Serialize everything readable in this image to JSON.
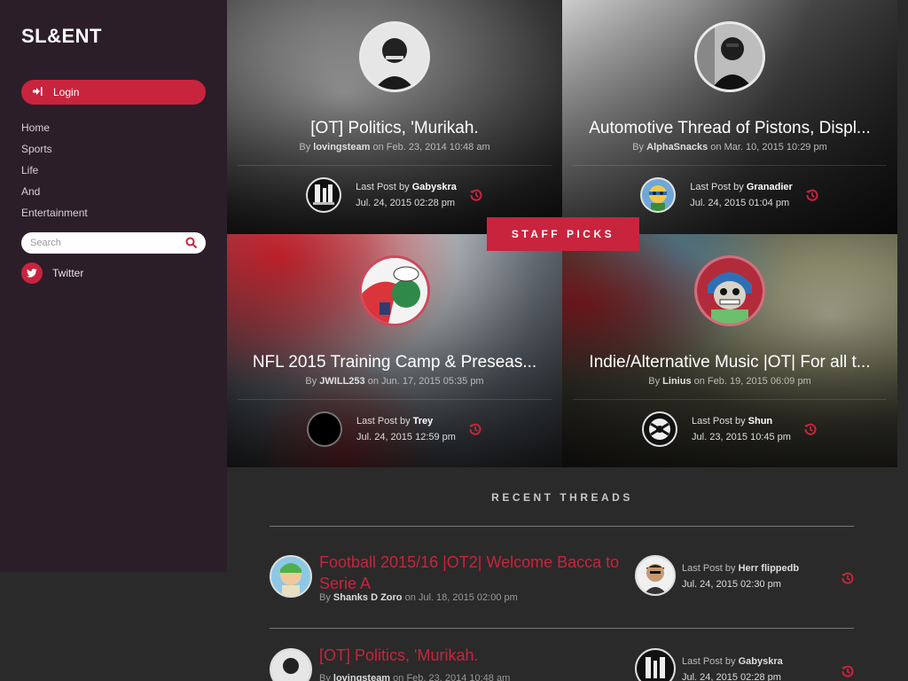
{
  "sidebar": {
    "logo": "SL&ENT",
    "login_label": "Login",
    "nav": [
      "Home",
      "Sports",
      "Life",
      "And",
      "Entertainment"
    ],
    "search_placeholder": "Search",
    "twitter_label": "Twitter"
  },
  "staff_picks_label": "STAFF PICKS",
  "tiles": [
    {
      "title": "[OT] Politics, 'Murikah.",
      "by": "By",
      "author": "lovingsteam",
      "on": "on Feb. 23, 2014 10:48 am",
      "last_post_label": "Last Post by",
      "last_user": "Gabyskra",
      "last_date": "Jul. 24, 2015 02:28 pm"
    },
    {
      "title": "Automotive Thread of Pistons, Displ...",
      "by": "By",
      "author": "AlphaSnacks",
      "on": "on Mar. 10, 2015 10:29 pm",
      "last_post_label": "Last Post by",
      "last_user": "Granadier",
      "last_date": "Jul. 24, 2015 01:04 pm"
    },
    {
      "title": "NFL 2015 Training Camp & Preseas...",
      "by": "By",
      "author": "JWILL253",
      "on": "on Jun. 17, 2015 05:35 pm",
      "last_post_label": "Last Post by",
      "last_user": "Trey",
      "last_date": "Jul. 24, 2015 12:59 pm"
    },
    {
      "title": "Indie/Alternative Music |OT| For all t...",
      "by": "By",
      "author": "Linius",
      "on": "on Feb. 19, 2015 06:09 pm",
      "last_post_label": "Last Post by",
      "last_user": "Shun",
      "last_date": "Jul. 23, 2015 10:45 pm"
    }
  ],
  "recent": {
    "title": "RECENT THREADS",
    "threads": [
      {
        "title": "Football 2015/16 |OT2| Welcome Bacca to Serie A",
        "by": "By",
        "author": "Shanks D Zoro",
        "on": "on Jul. 18, 2015 02:00 pm",
        "last_post_label": "Last Post by",
        "last_user": "Herr flippedb",
        "last_date": "Jul. 24, 2015 02:30 pm"
      },
      {
        "title": "[OT] Politics, 'Murikah.",
        "by": "By",
        "author": "lovingsteam",
        "on": "on Feb. 23, 2014 10:48 am",
        "last_post_label": "Last Post by",
        "last_user": "Gabyskra",
        "last_date": "Jul. 24, 2015 02:28 pm"
      }
    ]
  },
  "colors": {
    "accent": "#c8243d",
    "sidebar_bg": "#2b1e29",
    "page_bg": "#2a2a2a"
  }
}
